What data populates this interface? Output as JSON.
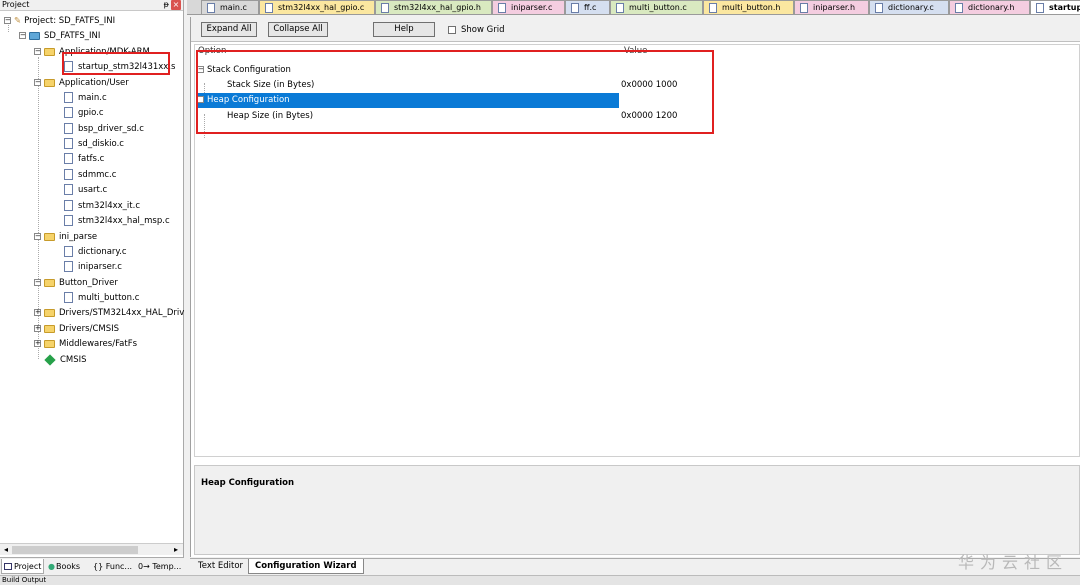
{
  "project_panel": {
    "title": "Project",
    "pin": "ᵽ",
    "close": "×",
    "tree": {
      "root": "Project: SD_FATFS_INI",
      "target": "SD_FATFS_INI",
      "groups": [
        {
          "name": "Application/MDK-ARM",
          "files": [
            "startup_stm32l431xx.s"
          ]
        },
        {
          "name": "Application/User",
          "files": [
            "main.c",
            "gpio.c",
            "bsp_driver_sd.c",
            "sd_diskio.c",
            "fatfs.c",
            "sdmmc.c",
            "usart.c",
            "stm32l4xx_it.c",
            "stm32l4xx_hal_msp.c"
          ]
        },
        {
          "name": "ini_parse",
          "files": [
            "dictionary.c",
            "iniparser.c"
          ]
        },
        {
          "name": "Button_Driver",
          "files": [
            "multi_button.c"
          ]
        },
        {
          "name": "Drivers/STM32L4xx_HAL_Driv",
          "files": []
        },
        {
          "name": "Drivers/CMSIS",
          "files": []
        },
        {
          "name": "Middlewares/FatFs",
          "files": []
        }
      ],
      "component": "CMSIS"
    },
    "tabs": [
      "Project",
      "Books",
      "{} Func...",
      "0→ Temp..."
    ]
  },
  "file_tabs": [
    "main.c",
    "stm32l4xx_hal_gpio.c",
    "stm32l4xx_hal_gpio.h",
    "iniparser.c",
    "ff.c",
    "multi_button.c",
    "multi_button.h",
    "iniparser.h",
    "dictionary.c",
    "dictionary.h",
    "startup"
  ],
  "file_tab_colors": [
    "#d8d8d8",
    "#fbe7a0",
    "#d9e9c0",
    "#f4cde0",
    "#d5dff0",
    "#d9e9c0",
    "#fbe7a0",
    "#f4cde0",
    "#d5dff0",
    "#f4cde0",
    "#ffffff"
  ],
  "toolbar": {
    "expand_all": "Expand All",
    "collapse_all": "Collapse All",
    "help": "Help",
    "show_grid": "Show Grid"
  },
  "config": {
    "col_option": "Option",
    "col_value": "Value",
    "rows": [
      {
        "label": "Stack Configuration",
        "value": ""
      },
      {
        "label": "Stack Size (in Bytes)",
        "value": "0x0000 1000"
      },
      {
        "label": "Heap Configuration",
        "value": ""
      },
      {
        "label": "Heap Size (in Bytes)",
        "value": "0x0000 1200"
      }
    ],
    "description": "Heap Configuration"
  },
  "bottom_tabs": [
    "Text Editor",
    "Configuration Wizard"
  ],
  "watermark": "华为云社区",
  "status": "Build Output",
  "colors": {
    "selection": "#0a7ad6",
    "highlight_box": "#e02020"
  }
}
